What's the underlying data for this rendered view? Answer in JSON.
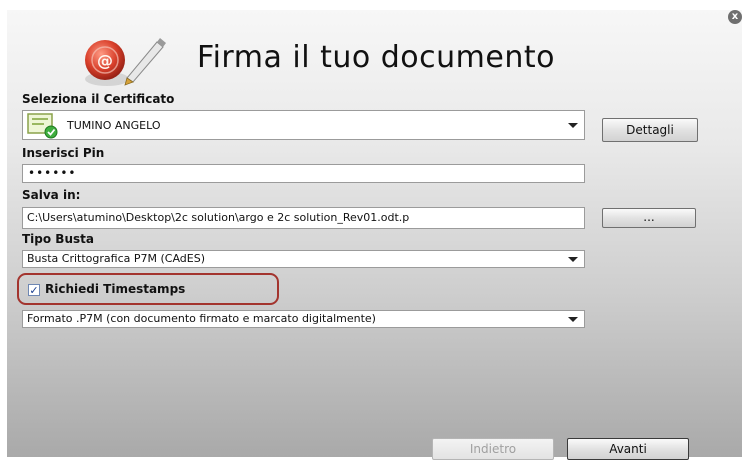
{
  "window": {
    "close_glyph": "x"
  },
  "header": {
    "title": "Firma il tuo documento",
    "logo_icon": "signature-seal-pen-icon"
  },
  "certificate": {
    "label": "Seleziona il Certificato",
    "selected": "TUMINO ANGELO",
    "icon": "certificate-icon",
    "details_button": "Dettagli"
  },
  "pin": {
    "label": "Inserisci Pin",
    "masked_value": "••••••"
  },
  "save": {
    "label": "Salva in:",
    "path": "C:\\Users\\atumino\\Desktop\\2c solution\\argo e 2c solution_Rev01.odt.p",
    "browse_button": "..."
  },
  "envelope": {
    "label": "Tipo Busta",
    "selected": "Busta Crittografica P7M (CAdES)"
  },
  "timestamp": {
    "label": "Richiedi Timestamps",
    "checked": true
  },
  "format": {
    "selected": "Formato .P7M (con documento firmato e marcato digitalmente)"
  },
  "footer": {
    "back_button": "Indietro",
    "next_button": "Avanti"
  },
  "colors": {
    "highlight": "#a3342e",
    "accent": "#1b3f8f"
  }
}
